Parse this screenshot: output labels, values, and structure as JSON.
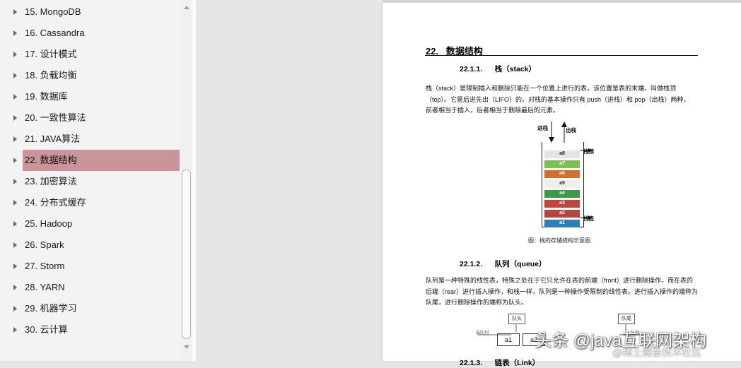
{
  "outline": {
    "items": [
      {
        "label": "15. MongoDB",
        "selected": false
      },
      {
        "label": "16. Cassandra",
        "selected": false
      },
      {
        "label": "17. 设计模式",
        "selected": false
      },
      {
        "label": "18. 负载均衡",
        "selected": false
      },
      {
        "label": "19. 数据库",
        "selected": false
      },
      {
        "label": "20. 一致性算法",
        "selected": false
      },
      {
        "label": "21. JAVA算法",
        "selected": false
      },
      {
        "label": "22. 数据结构",
        "selected": true
      },
      {
        "label": "23. 加密算法",
        "selected": false
      },
      {
        "label": "24. 分布式缓存",
        "selected": false
      },
      {
        "label": "25. Hadoop",
        "selected": false
      },
      {
        "label": "26. Spark",
        "selected": false
      },
      {
        "label": "27. Storm",
        "selected": false
      },
      {
        "label": "28. YARN",
        "selected": false
      },
      {
        "label": "29. 机器学习",
        "selected": false
      },
      {
        "label": "30. 云计算",
        "selected": false
      }
    ],
    "selected_color": "#c9959b"
  },
  "document": {
    "section_title": "22.   数据结构",
    "stack": {
      "heading": "22.1.1.      栈（stack）",
      "para_lines": [
        "栈（stack）是限制插入和删除只能在一个位置上进行的表，该位置是表的末端，叫做栈顶",
        "（top）。它是后进先出（LIFO）的。对栈的基本操作只有 push（进栈）和 pop（出栈）两种，",
        "前者相当于插入，后者相当于删除最后的元素。"
      ],
      "push_label": "进栈",
      "pop_label": "出栈",
      "top_label": "栈顶",
      "bottom_label": "栈底",
      "cells": [
        {
          "label": "a8",
          "color": "#e4e4e4",
          "text": "#222"
        },
        {
          "label": "a7",
          "color": "#7cc150",
          "text": "#fff"
        },
        {
          "label": "a6",
          "color": "#d4702c",
          "text": "#fff"
        },
        {
          "label": "a5",
          "color": "#eeeeee",
          "text": "#222"
        },
        {
          "label": "a4",
          "color": "#3c9a44",
          "text": "#fff"
        },
        {
          "label": "a3",
          "color": "#c0453a",
          "text": "#fff"
        },
        {
          "label": "a2",
          "color": "#b8453c",
          "text": "#fff"
        },
        {
          "label": "a1",
          "color": "#2e7db6",
          "text": "#fff"
        }
      ],
      "caption": "图：栈的存储结构示意图"
    },
    "queue": {
      "heading": "22.1.2.      队列（queue）",
      "para_lines": [
        "队列是一种特殊的线性表，特殊之处在于它只允许在表的前端（front）进行删除操作，而在表的",
        "后端（rear）进行插入操作，和栈一样，队列是一种操作受限制的线性表。进行插入操作的端称为",
        "队尾，进行删除操作的端称为队头。"
      ],
      "head_label": "队头",
      "tail_label": "队尾",
      "dequeue_label": "出队列",
      "enqueue_label": "入队列",
      "cells": [
        "a1",
        "a2"
      ]
    },
    "next_heading": "22.1.3.      链表（Link）"
  },
  "watermark": {
    "main": "头条 @java互联网架构",
    "sub": "@稀土掘金技术社区"
  }
}
